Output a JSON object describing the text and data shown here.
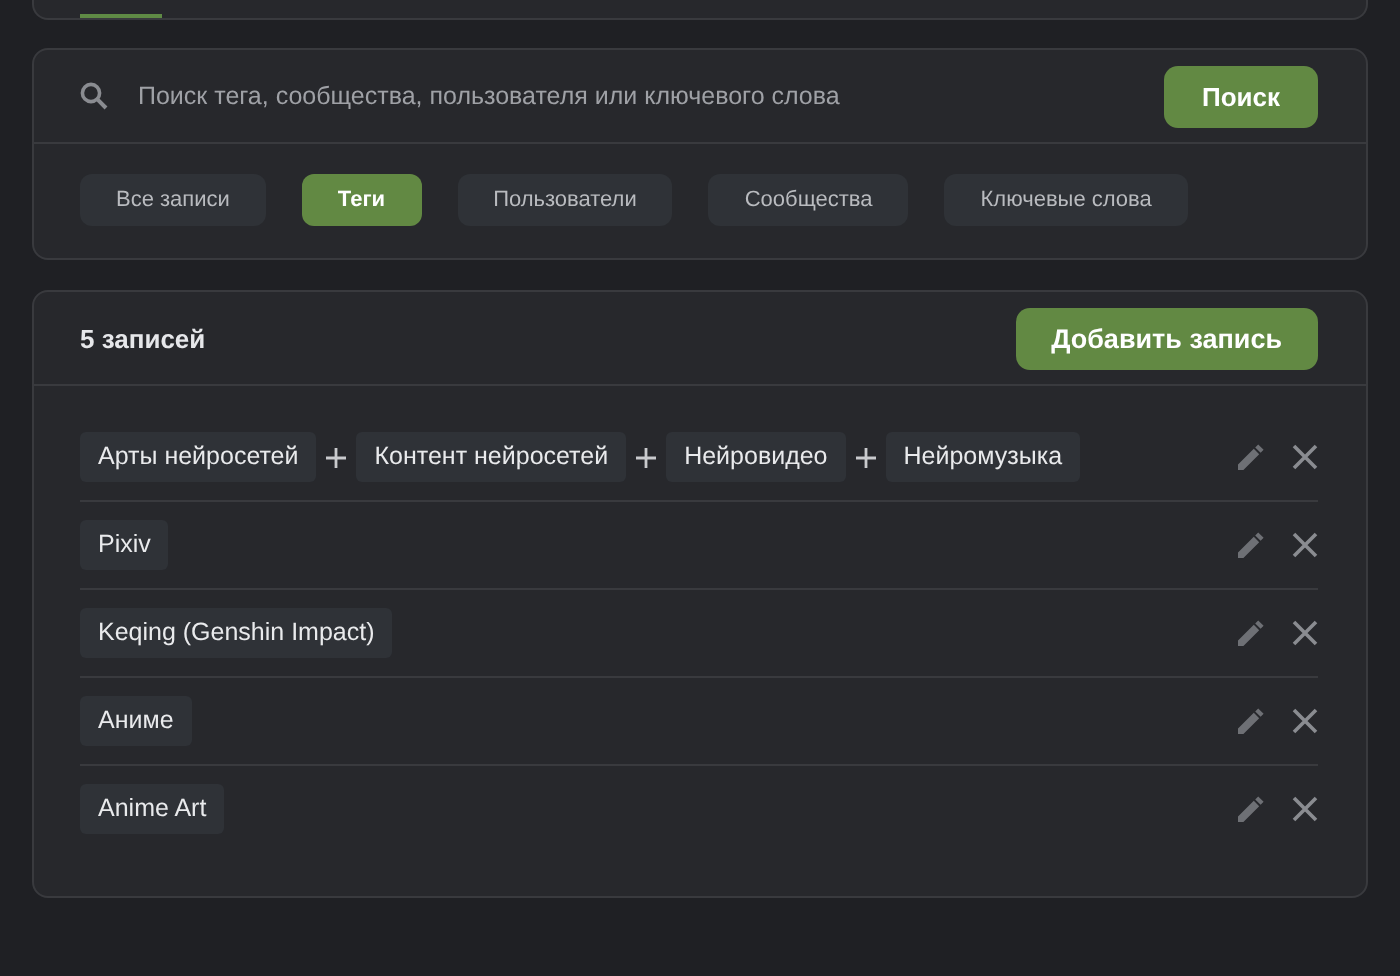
{
  "search": {
    "placeholder": "Поиск тега, сообщества, пользователя или ключевого слова",
    "button": "Поиск"
  },
  "filters": [
    {
      "label": "Все записи",
      "selected": false
    },
    {
      "label": "Теги",
      "selected": true
    },
    {
      "label": "Пользователи",
      "selected": false
    },
    {
      "label": "Сообщества",
      "selected": false
    },
    {
      "label": "Ключевые слова",
      "selected": false
    }
  ],
  "records": {
    "count": "5 записей",
    "add_button": "Добавить запись",
    "rows": [
      {
        "tags": [
          "Арты нейросетей",
          "Контент нейросетей",
          "Нейровидео",
          "Нейромузыка"
        ]
      },
      {
        "tags": [
          "Pixiv"
        ]
      },
      {
        "tags": [
          "Keqing (Genshin Impact)"
        ]
      },
      {
        "tags": [
          "Аниме"
        ]
      },
      {
        "tags": [
          "Anime Art"
        ]
      }
    ]
  }
}
